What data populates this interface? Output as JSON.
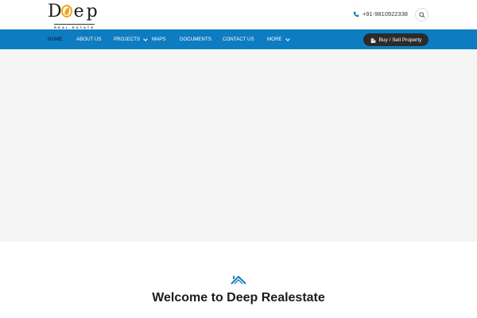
{
  "brand": {
    "name": "Deep",
    "tagline": "REAL ESTATE",
    "accent_color": "#f2a41c"
  },
  "header": {
    "phone": "+91-9810922338",
    "phone_icon": "phone-icon",
    "search_icon": "search-icon"
  },
  "nav": {
    "background": "#0e7cc1",
    "items": [
      {
        "label": "HOME",
        "active": true,
        "has_dropdown": false
      },
      {
        "label": "ABOUT US",
        "active": false,
        "has_dropdown": false
      },
      {
        "label": "PROJECTS",
        "active": false,
        "has_dropdown": true
      },
      {
        "label": "MAPS",
        "active": false,
        "has_dropdown": false
      },
      {
        "label": "DOCUMENTS",
        "active": false,
        "has_dropdown": false
      },
      {
        "label": "CONTACT US",
        "active": false,
        "has_dropdown": false
      },
      {
        "label": "MORE",
        "active": false,
        "has_dropdown": true
      }
    ],
    "cta_label": "Buy / Sell Property",
    "cta_icon": "building-icon"
  },
  "welcome": {
    "title": "Welcome to Deep Realestate",
    "icon": "roof-icon",
    "icon_color": "#0e7cc1"
  }
}
